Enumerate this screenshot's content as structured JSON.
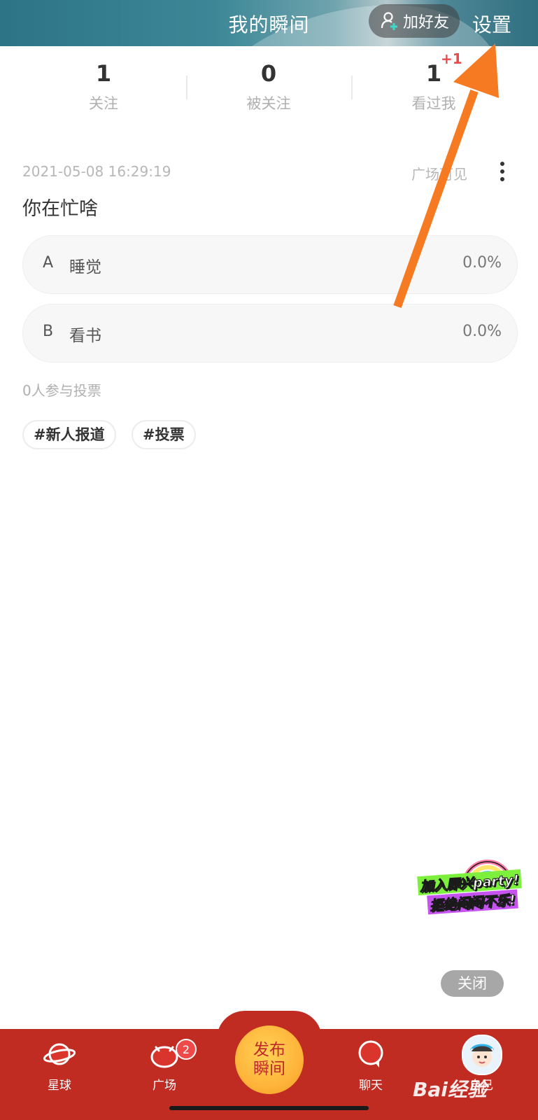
{
  "header": {
    "title": "我的瞬间",
    "add_friend_label": "加好友",
    "settings_label": "设置"
  },
  "stats": [
    {
      "value": "1",
      "label": "关注"
    },
    {
      "value": "0",
      "label": "被关注"
    },
    {
      "value": "1",
      "label": "看过我"
    }
  ],
  "stats_badge": "+1",
  "post": {
    "timestamp": "2021-05-08 16:29:19",
    "visibility": "广场可见",
    "question": "你在忙啥",
    "options": [
      {
        "key": "A",
        "text": "睡觉",
        "percent": "0.0%"
      },
      {
        "key": "B",
        "text": "看书",
        "percent": "0.0%"
      }
    ],
    "vote_summary": "0人参与投票",
    "tags": [
      "#新人报道",
      "#投票"
    ]
  },
  "promo": {
    "line1": "加入即兴party!",
    "line2": "拒绝闷闷不乐!"
  },
  "close_label": "关闭",
  "bottom_nav": {
    "items": [
      {
        "label": "星球",
        "icon": "planet-icon"
      },
      {
        "label": "广场",
        "icon": "square-icon",
        "badge": "2"
      },
      {
        "label": "聊天",
        "icon": "chat-bubble-icon"
      },
      {
        "label": "自己",
        "icon": "avatar"
      }
    ],
    "publish_line1": "发布",
    "publish_line2": "瞬间"
  },
  "watermark": "Bai经验",
  "colors": {
    "header": "#2d7486",
    "nav": "#c02b22",
    "publish": "#ffb43a",
    "arrow": "#f57a22",
    "badge": "#ee4a4a"
  }
}
